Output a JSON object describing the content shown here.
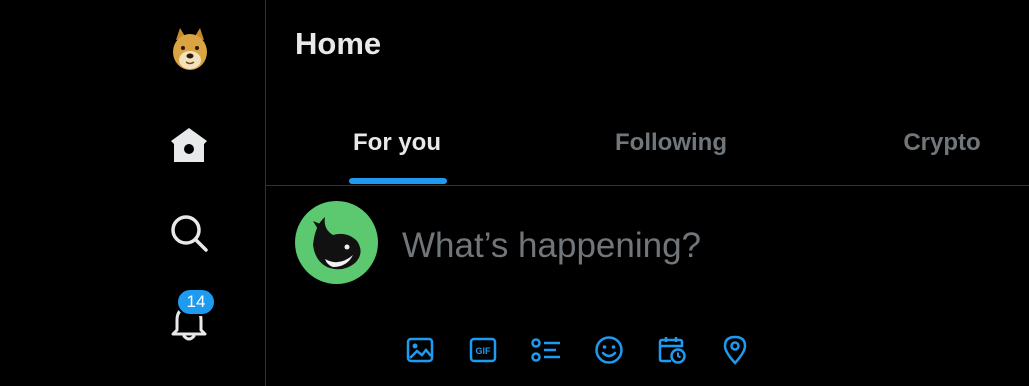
{
  "header": {
    "title": "Home"
  },
  "tabs": [
    {
      "label": "For you",
      "active": true
    },
    {
      "label": "Following",
      "active": false
    },
    {
      "label": "Crypto",
      "active": false
    }
  ],
  "sidebar": {
    "avatar_icon": "doge-avatar-icon",
    "items": [
      {
        "icon": "home-icon"
      },
      {
        "icon": "search-icon"
      },
      {
        "icon": "bell-icon",
        "badge": "14"
      }
    ]
  },
  "compose": {
    "placeholder": "What’s happening?",
    "avatar_icon": "whale-avatar-icon",
    "toolbar": [
      "image-icon",
      "gif-icon",
      "poll-icon",
      "emoji-icon",
      "schedule-icon",
      "location-icon"
    ]
  },
  "colors": {
    "accent": "#1d9bf0",
    "background": "#000000",
    "muted_text": "#71767b",
    "primary_text": "#e7e9ea",
    "avatar_bg": "#5cc86f"
  }
}
